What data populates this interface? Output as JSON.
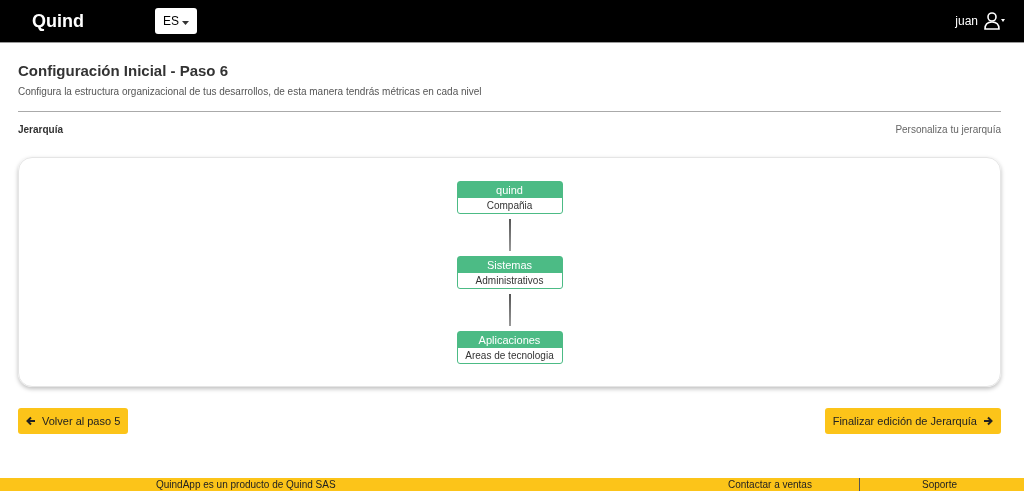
{
  "header": {
    "logo": "Quind",
    "language": "ES",
    "user": "juan"
  },
  "title": "Configuración Inicial - Paso 6",
  "subtitle": "Configura la estructura organizacional de tus desarrollos, de esta manera tendrás métricas en cada nivel",
  "section": {
    "label": "Jerarquía",
    "link": "Personaliza tu jerarquía"
  },
  "hierarchy": [
    {
      "name": "quind",
      "level_name": "Compañia"
    },
    {
      "name": "Sistemas",
      "level_name": "Administrativos"
    },
    {
      "name": "Aplicaciones",
      "level_name": "Areas de tecnologia"
    }
  ],
  "buttons": {
    "back": "Volver al paso 5",
    "finish": "Finalizar edición de Jerarquía"
  },
  "footer": {
    "product": "QuindApp es un producto de Quind SAS",
    "sales": "Contactar a ventas",
    "support": "Soporte"
  }
}
